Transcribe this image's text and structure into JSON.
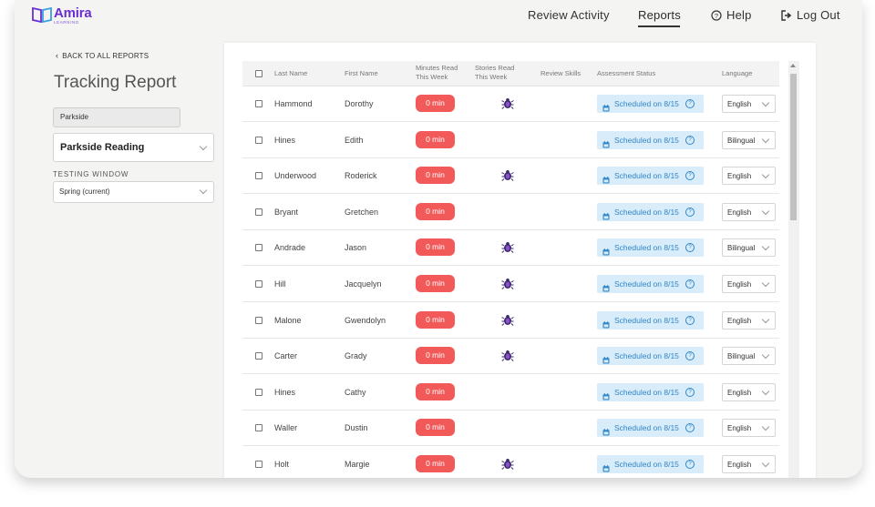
{
  "brand": {
    "name": "Amira",
    "tagline": "LEARNING",
    "color": "#6a2fd0"
  },
  "nav": {
    "review_activity": "Review Activity",
    "reports": "Reports",
    "help": "Help",
    "logout": "Log Out"
  },
  "sidebar": {
    "back_link": "BACK TO ALL REPORTS",
    "title": "Tracking Report",
    "school": "Parkside",
    "class": "Parkside Reading",
    "testing_window_label": "TESTING WINDOW",
    "testing_window_value": "Spring (current)"
  },
  "table": {
    "columns": {
      "last_name": "Last Name",
      "first_name": "First Name",
      "minutes_read_1": "Minutes Read",
      "minutes_read_2": "This Week",
      "stories_read_1": "Stories Read",
      "stories_read_2": "This Week",
      "review_skills": "Review Skills",
      "assessment_status": "Assessment Status",
      "language": "Language"
    },
    "rows": [
      {
        "last": "Hammond",
        "first": "Dorothy",
        "minutes": "0 min",
        "bug": true,
        "status": "Scheduled on 8/15",
        "language": "English"
      },
      {
        "last": "Hines",
        "first": "Edith",
        "minutes": "0 min",
        "bug": false,
        "status": "Scheduled on 8/15",
        "language": "Bilingual"
      },
      {
        "last": "Underwood",
        "first": "Roderick",
        "minutes": "0 min",
        "bug": true,
        "status": "Scheduled on 8/15",
        "language": "English"
      },
      {
        "last": "Bryant",
        "first": "Gretchen",
        "minutes": "0 min",
        "bug": false,
        "status": "Scheduled on 8/15",
        "language": "English"
      },
      {
        "last": "Andrade",
        "first": "Jason",
        "minutes": "0 min",
        "bug": true,
        "status": "Scheduled on 8/15",
        "language": "Bilingual"
      },
      {
        "last": "Hill",
        "first": "Jacquelyn",
        "minutes": "0 min",
        "bug": true,
        "status": "Scheduled on 8/15",
        "language": "English"
      },
      {
        "last": "Malone",
        "first": "Gwendolyn",
        "minutes": "0 min",
        "bug": true,
        "status": "Scheduled on 8/15",
        "language": "English"
      },
      {
        "last": "Carter",
        "first": "Grady",
        "minutes": "0 min",
        "bug": true,
        "status": "Scheduled on 8/15",
        "language": "Bilingual"
      },
      {
        "last": "Hines",
        "first": "Cathy",
        "minutes": "0 min",
        "bug": false,
        "status": "Scheduled on 8/15",
        "language": "English"
      },
      {
        "last": "Waller",
        "first": "Dustin",
        "minutes": "0 min",
        "bug": false,
        "status": "Scheduled on 8/15",
        "language": "English"
      },
      {
        "last": "Holt",
        "first": "Margie",
        "minutes": "0 min",
        "bug": true,
        "status": "Scheduled on 8/15",
        "language": "English"
      }
    ]
  },
  "colors": {
    "minutes_pill": "#f25a5a",
    "status_badge_bg": "#d9ecf9",
    "status_badge_text": "#2f86c7"
  },
  "icons": {
    "story": "bug-icon",
    "status": "calendar-icon",
    "status_help": "question-circle-icon"
  }
}
